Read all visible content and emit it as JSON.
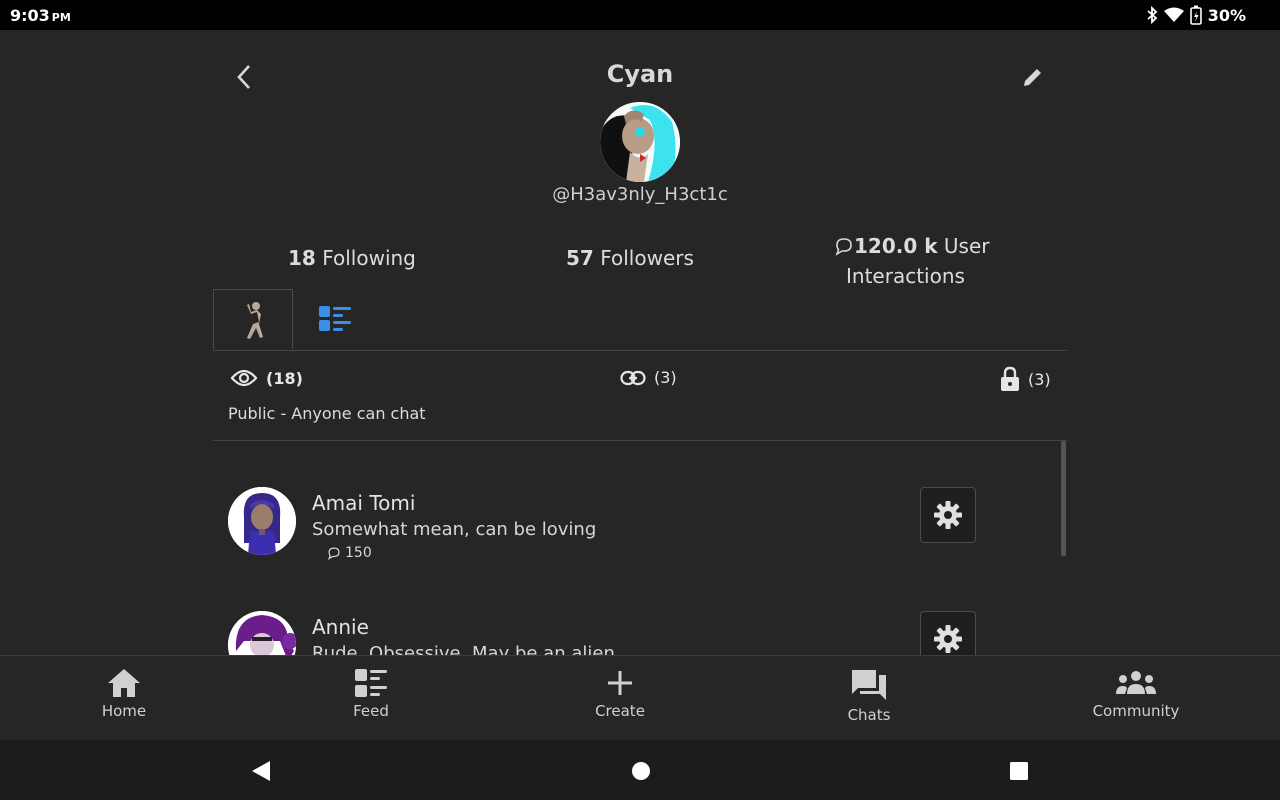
{
  "status": {
    "time": "9:03",
    "ampm": "PM",
    "battery": "30%"
  },
  "header": {
    "title": "Cyan",
    "handle": "@H3av3nly_H3ct1c"
  },
  "stats": {
    "following_count": "18",
    "following_label": "Following",
    "followers_count": "57",
    "followers_label": "Followers",
    "interactions_count": "120.0 k",
    "interactions_label_1": "User",
    "interactions_label_2": "Interactions"
  },
  "tabs": [
    {
      "icon": "character-icon",
      "active": true
    },
    {
      "icon": "feed-list-icon",
      "active": false
    }
  ],
  "visibility": {
    "public_count": "(18)",
    "link_count": "(3)",
    "private_count": "(3)",
    "description": "Public - Anyone can chat"
  },
  "characters": [
    {
      "name": "Amai Tomi",
      "description": "Somewhat mean, can be loving",
      "interactions": "150"
    },
    {
      "name": "Annie",
      "description": "Rude, Obsessive, May be an alien",
      "interactions": ""
    }
  ],
  "bottom_nav": [
    {
      "label": "Home",
      "icon": "home-icon"
    },
    {
      "label": "Feed",
      "icon": "feed-icon"
    },
    {
      "label": "Create",
      "icon": "plus-icon"
    },
    {
      "label": "Chats",
      "icon": "chats-icon"
    },
    {
      "label": "Community",
      "icon": "community-icon"
    }
  ],
  "colors": {
    "background": "#262626",
    "accent_blue": "#3d8fe6",
    "avatar_cyan": "#35e0f0"
  }
}
